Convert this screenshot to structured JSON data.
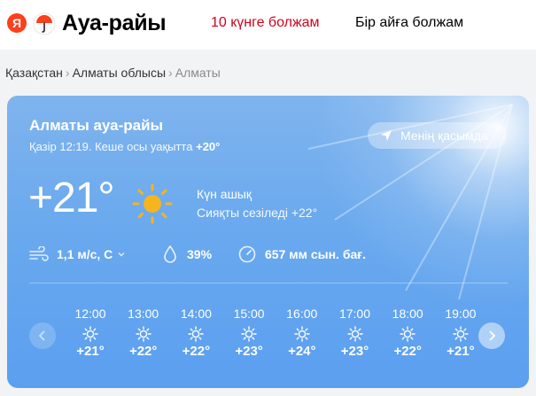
{
  "header": {
    "logo_letter": "Я",
    "brand": "Ауа-райы",
    "nav": {
      "ten_day": "10 күнге болжам",
      "month": "Бір айға болжам"
    }
  },
  "breadcrumb": {
    "country": "Қазақстан",
    "region": "Алматы облысы",
    "city": "Алматы",
    "separator": "›"
  },
  "current": {
    "title": "Алматы ауа-райы",
    "time_prefix": "Қазір 12:19. Кеше осы уақытта",
    "yesterday_temp": "+20°",
    "location_button": "Менің қасымда",
    "temperature": "+21°",
    "condition": "Күн ашық",
    "feels_like": "Сияқты сезіледі +22°",
    "wind_value": "1,1 м/с, С",
    "humidity": "39%",
    "pressure": "657 мм сын. бағ."
  },
  "hourly": [
    {
      "time": "12:00",
      "temp": "+21°"
    },
    {
      "time": "13:00",
      "temp": "+22°"
    },
    {
      "time": "14:00",
      "temp": "+22°"
    },
    {
      "time": "15:00",
      "temp": "+23°"
    },
    {
      "time": "16:00",
      "temp": "+24°"
    },
    {
      "time": "17:00",
      "temp": "+23°"
    },
    {
      "time": "18:00",
      "temp": "+22°"
    },
    {
      "time": "19:00",
      "temp": "+21°"
    }
  ],
  "colors": {
    "brand_red": "#fc3f1d",
    "nav_active": "#d0021b",
    "sun": "#f6b41e",
    "card_blue": "#6aa9ee"
  },
  "icons": {
    "wind": "wind-icon",
    "humidity": "drop-icon",
    "pressure": "gauge-icon",
    "weather": "sun-icon"
  }
}
